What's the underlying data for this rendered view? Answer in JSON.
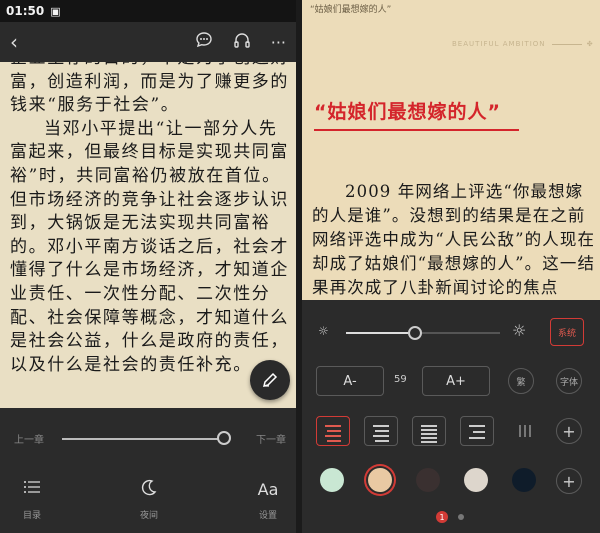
{
  "statusbar": {
    "time": "01:50"
  },
  "left": {
    "paragraphs": [
      {
        "indent": false,
        "text": "企业生存的目的，不是为了创造财富，创造利润，而是为了赚更多的钱来“服务于社会”。"
      },
      {
        "indent": true,
        "text": "当邓小平提出“让一部分人先富起来，但最终目标是实现共同富裕”时，共同富裕仍被放在首位。但市场经济的竞争让社会逐步认识到，大锅饭是无法实现共同富裕的。邓小平南方谈话之后，社会才懂得了什么是市场经济，才知道企业责任、一次性分配、二次性分配、社会保障等概念，才知道什么是社会公益，什么是政府的责任，以及什么是社会的责任补充。"
      }
    ],
    "chapter": {
      "prev_label": "上一章",
      "next_label": "下一章",
      "progress": 1.0
    },
    "tabs": [
      {
        "icon": "list-icon",
        "label": "目录"
      },
      {
        "icon": "moon-icon",
        "label": "夜间"
      },
      {
        "icon": "font-icon",
        "label": "设置"
      }
    ]
  },
  "right": {
    "header": "“姑娘们最想嫁的人”",
    "brand": "BEAUTIFUL AMBITION",
    "chapter_title": "“姑娘们最想嫁的人”",
    "paragraph": "2009 年网络上评选“你最想嫁的人是谁”。没想到的结果是在之前网络评选中成为“人民公敌”的人现在却成了姑娘们“最想嫁的人”。这一结果再次成了八卦新闻讨论的焦点",
    "settings": {
      "brightness": 0.45,
      "system_label": "系统",
      "font_minus": "A-",
      "font_plus": "A+",
      "font_size": "59",
      "traditional_label": "繁",
      "font_label": "字体",
      "page_current": "1"
    }
  },
  "colors": {
    "accent": "#d23b36",
    "swatches": [
      "#c9e7d3",
      "#e9c9a3",
      "#3a3030",
      "#ddd6cc",
      "#0f1c2a"
    ]
  }
}
